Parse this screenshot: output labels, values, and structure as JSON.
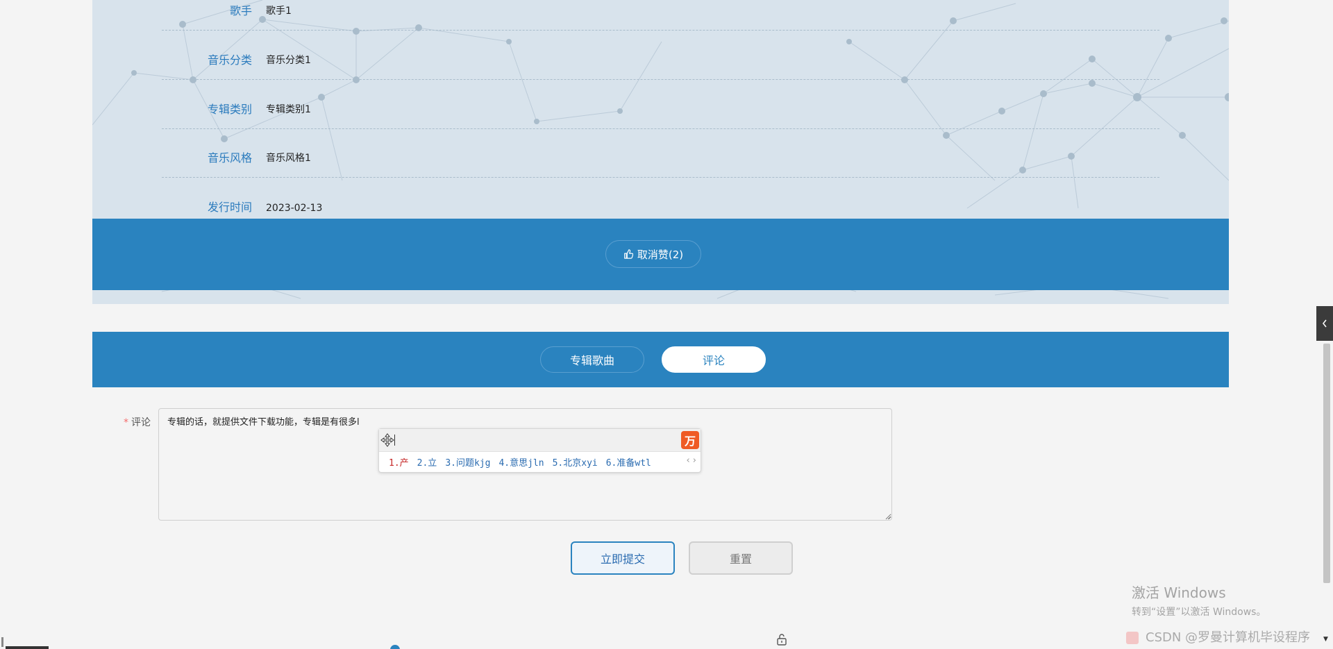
{
  "album_info": {
    "fields": [
      {
        "label": "歌手",
        "value": "歌手1"
      },
      {
        "label": "音乐分类",
        "value": "音乐分类1"
      },
      {
        "label": "专辑类别",
        "value": "专辑类别1"
      },
      {
        "label": "音乐风格",
        "value": "音乐风格1"
      },
      {
        "label": "发行时间",
        "value": "2023-02-13"
      }
    ],
    "like_button_label": "取消赞(2)",
    "like_icon": "thumbs-up-icon"
  },
  "tabs": [
    {
      "label": "专辑歌曲",
      "active": false
    },
    {
      "label": "评论",
      "active": true
    }
  ],
  "comment_form": {
    "label": "评论",
    "required_mark": "*",
    "value": "专辑的话，就提供文件下载功能，专辑是有很多l",
    "submit_label": "立即提交",
    "reset_label": "重置"
  },
  "ime": {
    "logo": "万",
    "candidates": [
      "1.产",
      "2.立",
      "3.问题kjg",
      "4.意思jln",
      "5.北京xyi",
      "6.准备wtl"
    ],
    "pager": "‹ ›"
  },
  "side_toggle_icon": "chevron-left-icon",
  "watermark": {
    "activate_title": "激活 Windows",
    "activate_sub": "转到“设置”以激活 Windows。",
    "csdn": "CSDN @罗曼计算机毕设程序"
  },
  "colors": {
    "primary": "#2a83bf",
    "panel_bg": "#d8e3ec",
    "label": "#2b7bbd"
  }
}
